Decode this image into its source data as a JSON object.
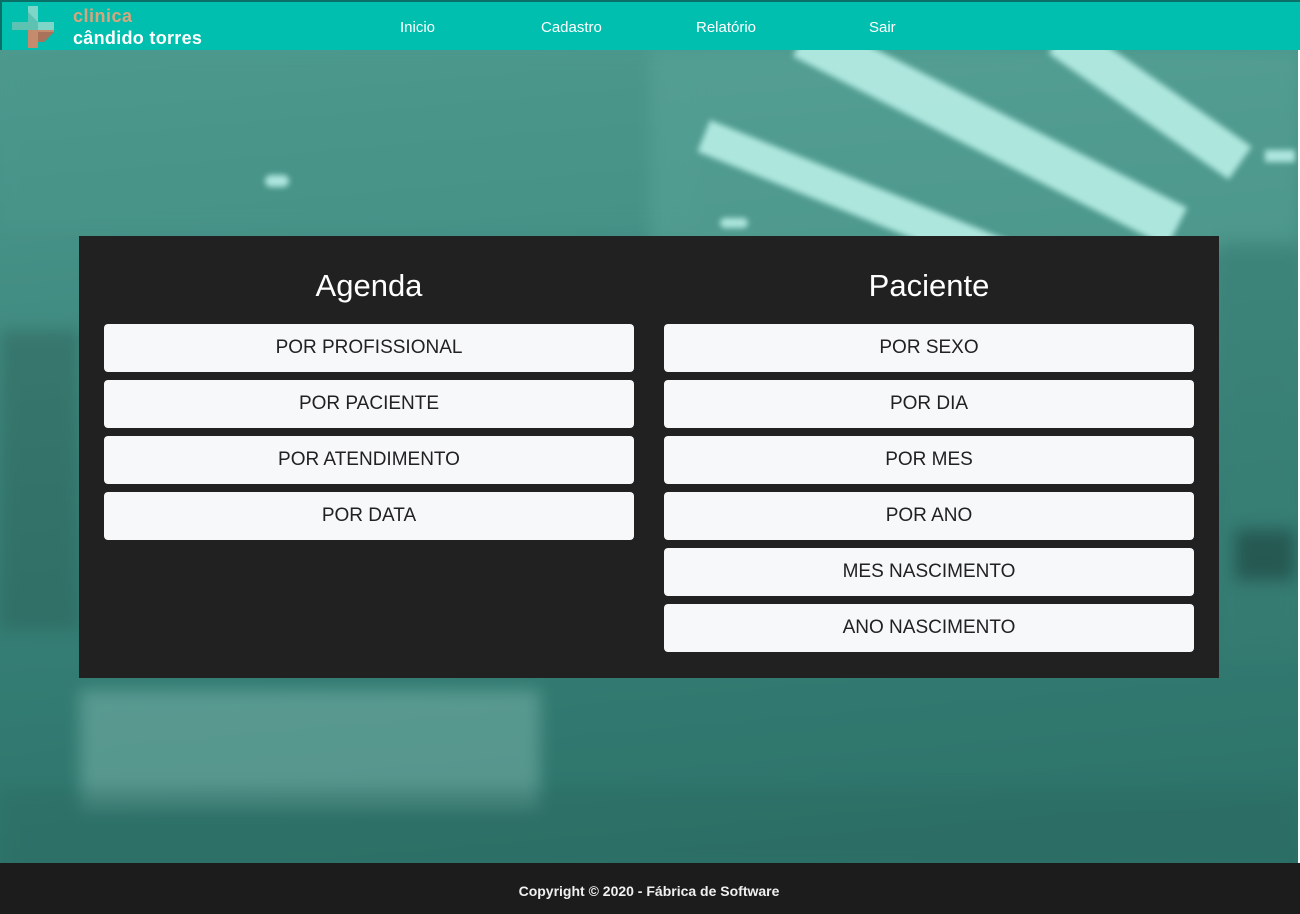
{
  "brand": {
    "line1": "clinica",
    "line2": "cândido torres",
    "colors": {
      "navbar": "#00bfae",
      "logo_accent": "#d9a57c",
      "logo_mark_light": "#7dd6c8",
      "logo_mark_dark": "#c48c6d"
    }
  },
  "nav": {
    "items": [
      {
        "label": "Inicio"
      },
      {
        "label": "Cadastro"
      },
      {
        "label": "Relatório"
      },
      {
        "label": "Sair"
      }
    ]
  },
  "panel": {
    "agenda": {
      "title": "Agenda",
      "buttons": [
        "POR PROFISSIONAL",
        "POR PACIENTE",
        "POR ATENDIMENTO",
        "POR DATA"
      ]
    },
    "paciente": {
      "title": "Paciente",
      "buttons": [
        "POR SEXO",
        "POR DIA",
        "POR MES",
        "POR ANO",
        "MES NASCIMENTO",
        "ANO NASCIMENTO"
      ]
    }
  },
  "footer": {
    "text": "Copyright © 2020 - Fábrica de Software"
  }
}
